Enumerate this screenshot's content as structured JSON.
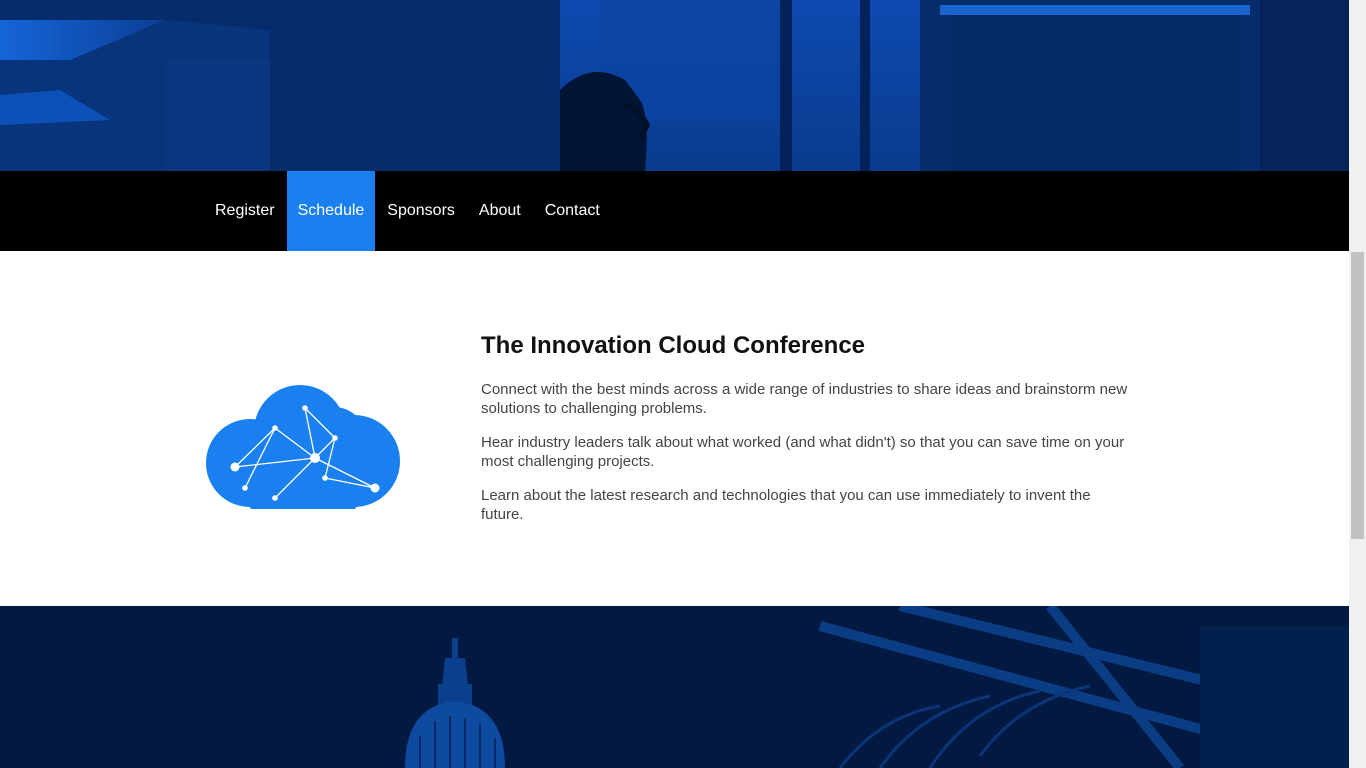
{
  "nav": {
    "items": [
      {
        "label": "Register",
        "active": false
      },
      {
        "label": "Schedule",
        "active": true
      },
      {
        "label": "Sponsors",
        "active": false
      },
      {
        "label": "About",
        "active": false
      },
      {
        "label": "Contact",
        "active": false
      }
    ]
  },
  "intro": {
    "title": "The Innovation Cloud Conference",
    "paragraphs": [
      "Connect with the best minds across a wide range of industries to share ideas and brainstorm new solutions to challenging problems.",
      "Hear industry leaders talk about what worked (and what didn't) so that you can save time on your most challenging projects.",
      "Learn about the latest research and technologies that you can use immediately to invent the future."
    ]
  },
  "images": {
    "top": "hero-office-image",
    "logo": "cloud-network-icon",
    "bottom": "hero-city-image"
  },
  "colors": {
    "accent": "#1a80f0",
    "nav_bg": "#000000",
    "hero_tint": "#0a3d8c"
  }
}
